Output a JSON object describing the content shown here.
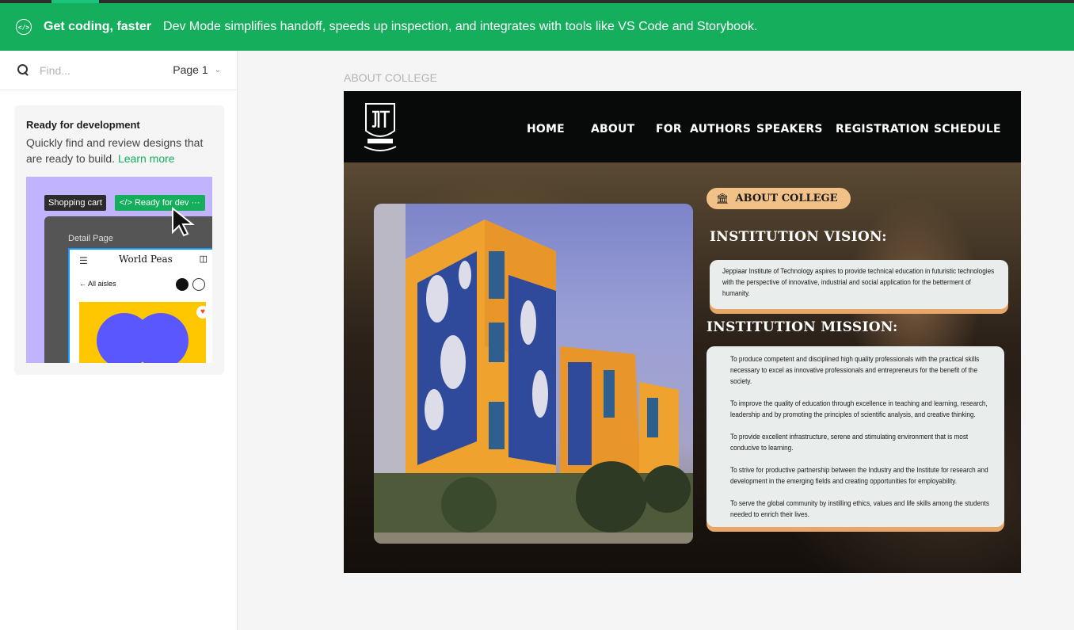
{
  "banner": {
    "title": "Get coding, faster",
    "text": "Dev Mode simplifies handoff, speeds up inspection, and integrates with tools like VS Code and Storybook."
  },
  "sidebar": {
    "search_placeholder": "Find...",
    "page_label": "Page 1",
    "card": {
      "title": "Ready for development",
      "description": "Quickly find and review designs that are ready to build.",
      "link": "Learn more",
      "preview": {
        "cart_label": "Shopping cart",
        "ready_label": "Ready for dev",
        "more_label": "···",
        "detail_label": "Detail Page",
        "brand": "World Peas",
        "aisles": "All aisles"
      }
    }
  },
  "canvas": {
    "frame_label": "ABOUT COLLEGE",
    "nav": [
      "HOME",
      "ABOUT",
      "FOR  AUTHORS",
      "SPEAKERS",
      "REGISTRATION",
      "SCHEDULE"
    ],
    "pill": "ABOUT COLLEGE",
    "vision_heading": "INSTITUTION VISION:",
    "vision_text": "Jeppiaar Institute of Technology aspires to provide technical education in futuristic technologies with the perspective of innovative, industrial and social application for the betterment of humanity.",
    "mission_heading": "INSTITUTION MISSION:",
    "mission": [
      "To produce competent and disciplined high quality professionals with the practical skills necessary to excel as innovative professionals and entrepreneurs for the benefit of the society.",
      "To improve the quality of education through excellence in teaching and learning, research, leadership and by promoting the principles of scientific analysis, and creative thinking.",
      "To provide excellent infrastructure, serene and stimulating environment that is most conducive to learning.",
      "To strive for productive partnership between the Industry and the Institute for research and development in the emerging fields and creating opportunities for employability.",
      "To serve the global community by instilling ethics, values and life skills among the students needed to enrich their lives."
    ]
  },
  "colors": {
    "banner_green": "#14ae5c",
    "accent_orange": "#f1c187",
    "mission_shadow": "#e8a768",
    "nav_bg": "#080a0a"
  }
}
